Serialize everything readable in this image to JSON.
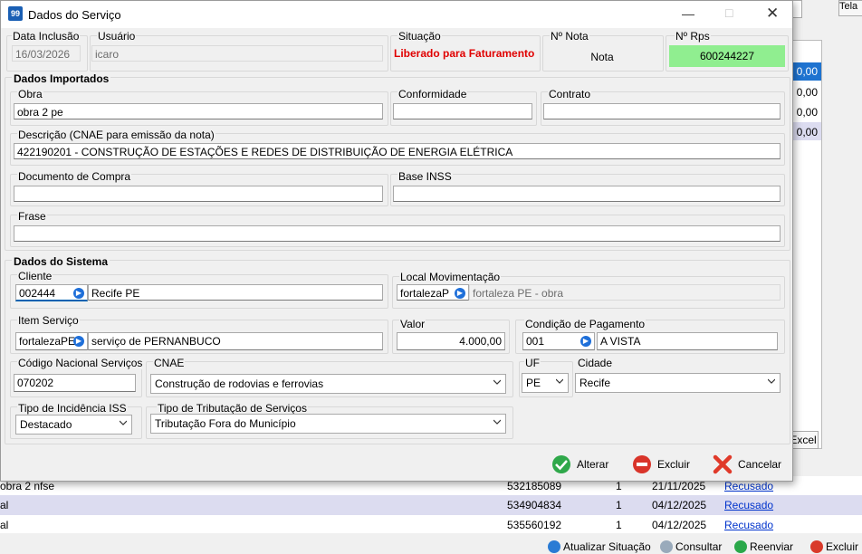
{
  "background": {
    "grid_values": [
      "0,00",
      "0,00",
      "0,00",
      "0,00"
    ],
    "corner_label": "Tela",
    "excel_label": "Excel",
    "rows": [
      {
        "desc": "obra 2 nfse",
        "number": "532185089",
        "qty": "1",
        "date": "21/11/2025",
        "status": "Recusado"
      },
      {
        "desc": "al",
        "number": "534904834",
        "qty": "1",
        "date": "04/12/2025",
        "status": "Recusado"
      },
      {
        "desc": "al",
        "number": "535560192",
        "qty": "1",
        "date": "04/12/2025",
        "status": "Recusado"
      }
    ],
    "bottom_buttons": {
      "atualizar": "Atualizar Situação",
      "consultar": "Consultar",
      "reenviar": "Reenviar",
      "excluir": "Excluir"
    }
  },
  "dialog": {
    "title": "Dados do Serviço",
    "header": {
      "data_inclusao_label": "Data Inclusão",
      "data_inclusao_value": "16/03/2026",
      "usuario_label": "Usuário",
      "usuario_value": "icaro",
      "situacao_label": "Situação",
      "situacao_value": "Liberado para Faturamento",
      "nota_label": "Nº Nota",
      "nota_value": "Nota",
      "rps_label": "Nº Rps",
      "rps_value": "600244227"
    },
    "importados": {
      "section": "Dados Importados",
      "obra_label": "Obra",
      "obra_value": "obra 2 pe",
      "conformidade_label": "Conformidade",
      "conformidade_value": "",
      "contrato_label": "Contrato",
      "contrato_value": "",
      "descricao_label": "Descrição (CNAE para emissão da nota)",
      "descricao_value": "422190201 - CONSTRUÇÃO DE ESTAÇÕES E REDES DE DISTRIBUIÇÃO DE ENERGIA ELÉTRICA",
      "doc_compra_label": "Documento de Compra",
      "doc_compra_value": "",
      "base_inss_label": "Base INSS",
      "base_inss_value": "",
      "frase_label": "Frase",
      "frase_value": ""
    },
    "sistema": {
      "section": "Dados do Sistema",
      "cliente_label": "Cliente",
      "cliente_code": "002444",
      "cliente_name": "Recife PE",
      "local_label": "Local Movimentação",
      "local_code": "fortalezaP",
      "local_name": "fortaleza PE - obra",
      "item_label": "Item Serviço",
      "item_code": "fortalezaPE",
      "item_name": "serviço de PERNANBUCO",
      "valor_label": "Valor",
      "valor_value": "4.000,00",
      "cond_label": "Condição de Pagamento",
      "cond_code": "001",
      "cond_name": "A VISTA",
      "cns_label": "Código Nacional Serviços",
      "cns_value": "070202",
      "cnae_label": "CNAE",
      "cnae_value": "Construção de rodovias e ferrovias",
      "uf_label": "UF",
      "uf_value": "PE",
      "cidade_label": "Cidade",
      "cidade_value": "Recife",
      "iss_label": "Tipo de Incidência ISS",
      "iss_value": "Destacado",
      "trib_label": "Tipo de Tributação de Serviços",
      "trib_value": "Tributação Fora do Município"
    },
    "buttons": {
      "alterar": "Alterar",
      "excluir": "Excluir",
      "cancelar": "Cancelar"
    },
    "colors": {
      "situacao": "#e00000",
      "rps_bg": "#90ee90",
      "accent": "#0063b1"
    }
  }
}
